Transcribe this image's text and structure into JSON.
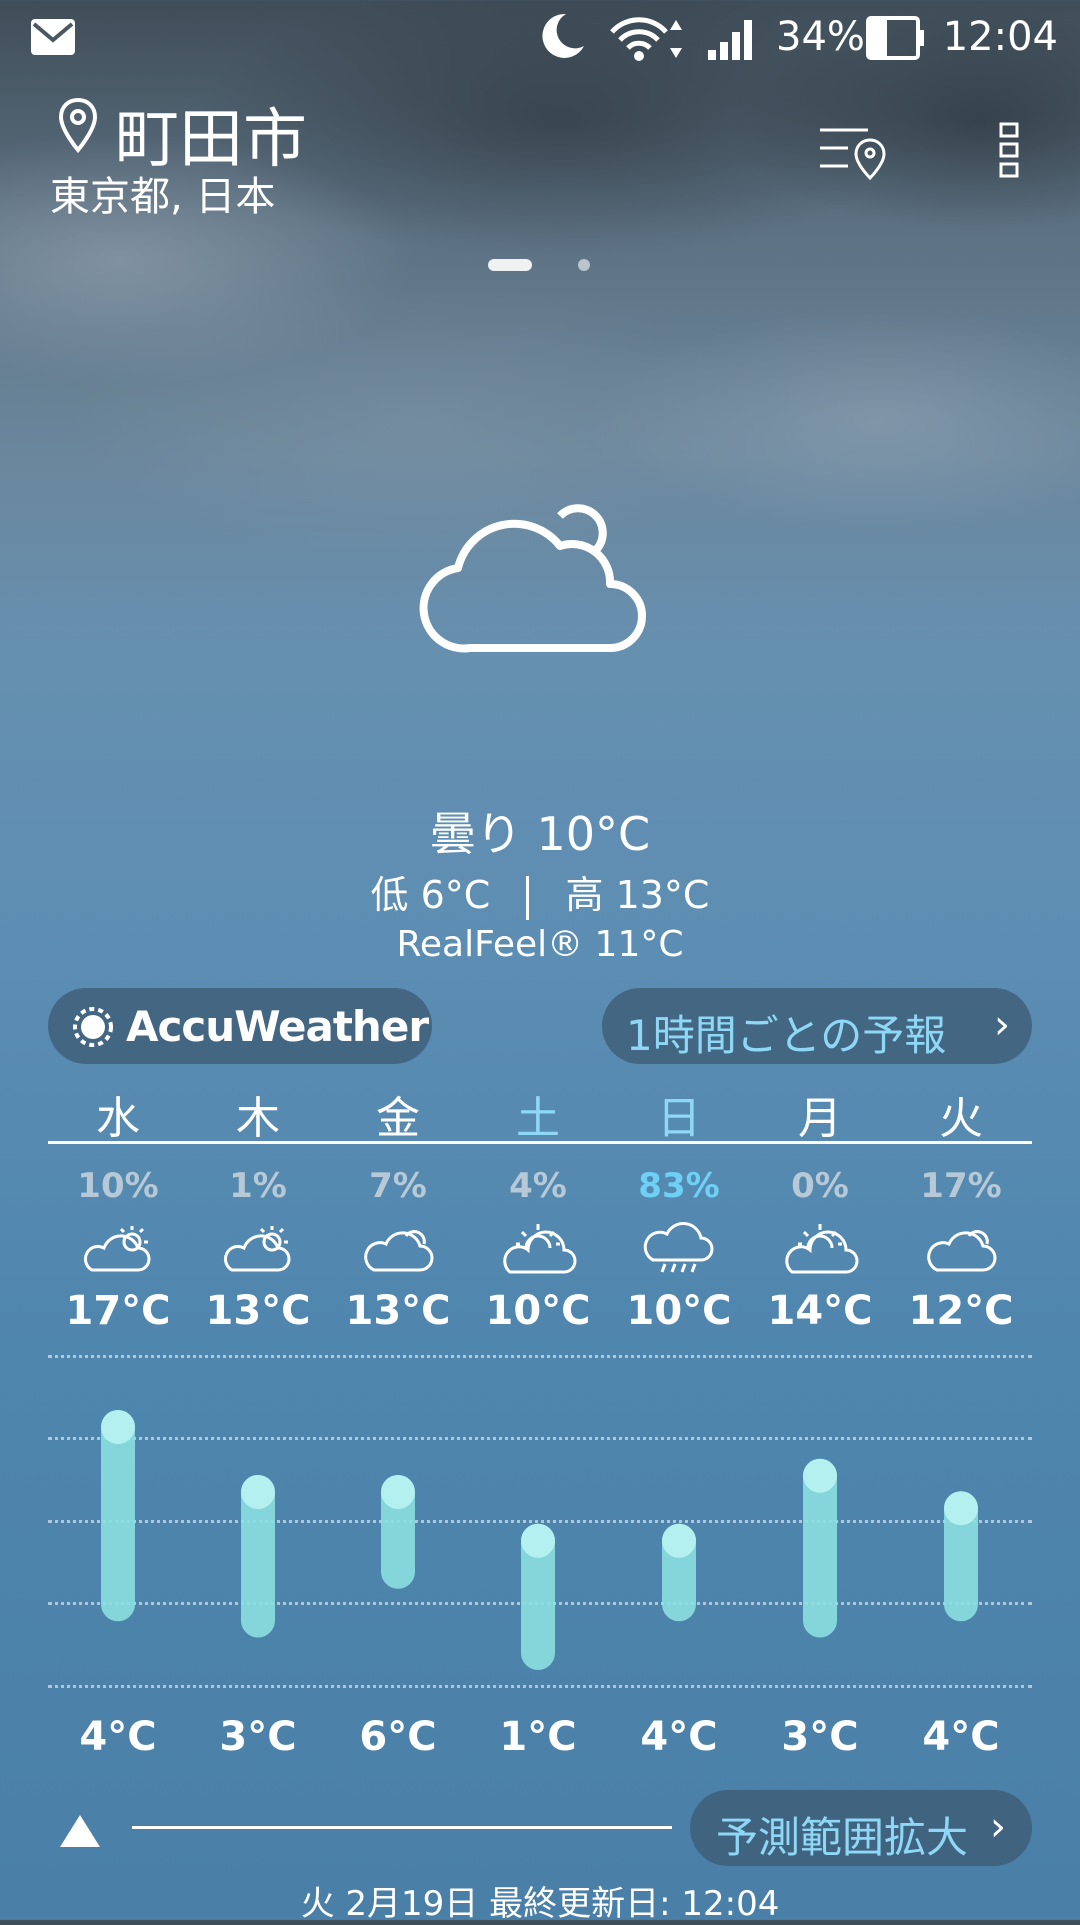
{
  "status_bar": {
    "battery": "34%",
    "time": "12:04",
    "icons": [
      "mail-icon",
      "moon-icon",
      "wifi-icon",
      "signal-icon",
      "battery-icon"
    ]
  },
  "location": {
    "city": "町田市",
    "region": "東京都, 日本"
  },
  "page_dots": {
    "count": 2,
    "active": 0
  },
  "current": {
    "condition": "曇り 10°C",
    "low": "低 6°C",
    "high": "高 13°C",
    "realfeel": "RealFeel® 11°C",
    "icon": "cloud-icon"
  },
  "accuweather_label": "AccuWeather",
  "hourly_label": "1時間ごとの予報",
  "forecast": {
    "days": [
      {
        "name": "水",
        "precip": "10%",
        "icon": "partly-cloudy-icon",
        "high": "17°C",
        "low": "4°C",
        "weekend": false
      },
      {
        "name": "木",
        "precip": "1%",
        "icon": "partly-cloudy-icon",
        "high": "13°C",
        "low": "3°C",
        "weekend": false
      },
      {
        "name": "金",
        "precip": "7%",
        "icon": "cloud-icon",
        "high": "13°C",
        "low": "6°C",
        "weekend": false
      },
      {
        "name": "土",
        "precip": "4%",
        "icon": "sun-behind-cloud-icon",
        "high": "10°C",
        "low": "1°C",
        "weekend": true
      },
      {
        "name": "日",
        "precip": "83%",
        "icon": "rain-icon",
        "high": "10°C",
        "low": "4°C",
        "weekend": true
      },
      {
        "name": "月",
        "precip": "0%",
        "icon": "sun-behind-cloud-icon",
        "high": "14°C",
        "low": "3°C",
        "weekend": false
      },
      {
        "name": "火",
        "precip": "17%",
        "icon": "cloud-icon",
        "high": "12°C",
        "low": "4°C",
        "weekend": false
      }
    ],
    "colors": {
      "weekend": "#8ed8f5",
      "precip_high": "#6fd0f5",
      "precip_normal": "#b7c9d6",
      "bar": "#8bdfe0"
    }
  },
  "expand_label": "予測範囲拡大",
  "updated": "火 2月19日 最終更新日: 12:04"
}
